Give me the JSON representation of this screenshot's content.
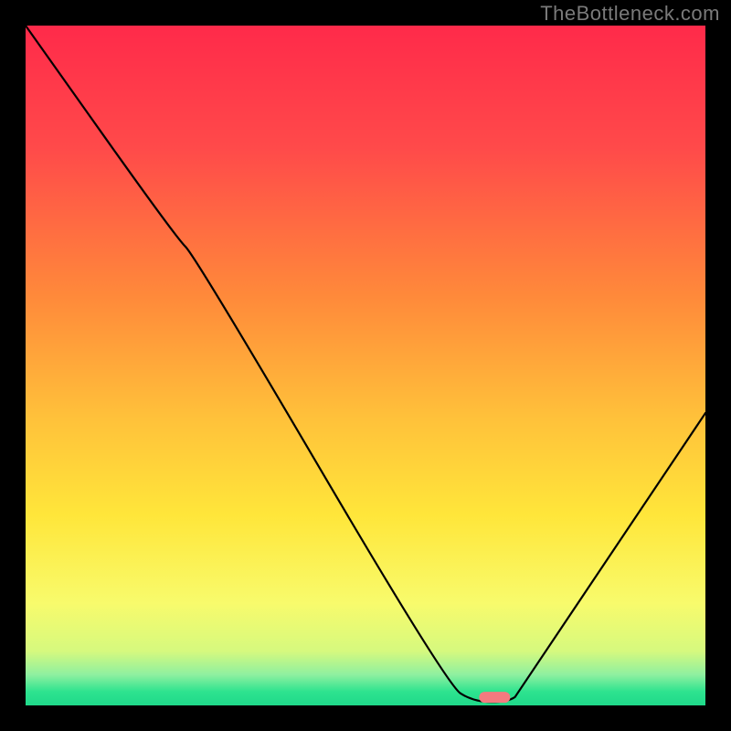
{
  "watermark": "TheBottleneck.com",
  "chart_data": {
    "type": "line",
    "title": "",
    "xlabel": "",
    "ylabel": "",
    "xlim": [
      0,
      100
    ],
    "ylim": [
      0,
      100
    ],
    "curve": [
      {
        "x": 0,
        "y": 100
      },
      {
        "x": 22,
        "y": 69
      },
      {
        "x": 25,
        "y": 66
      },
      {
        "x": 62,
        "y": 3
      },
      {
        "x": 66,
        "y": 0.5
      },
      {
        "x": 71,
        "y": 0.5
      },
      {
        "x": 73,
        "y": 2
      },
      {
        "x": 100,
        "y": 43
      }
    ],
    "marker": {
      "x": 69,
      "y": 1.2,
      "color": "#f47a7f"
    },
    "background_gradient": {
      "stops": [
        {
          "offset": 0.0,
          "color": "#ff2a4a"
        },
        {
          "offset": 0.18,
          "color": "#ff4a4a"
        },
        {
          "offset": 0.4,
          "color": "#ff8a3a"
        },
        {
          "offset": 0.58,
          "color": "#ffc23a"
        },
        {
          "offset": 0.72,
          "color": "#ffe63a"
        },
        {
          "offset": 0.85,
          "color": "#f8fb6c"
        },
        {
          "offset": 0.92,
          "color": "#d6f97e"
        },
        {
          "offset": 0.955,
          "color": "#8ef0a0"
        },
        {
          "offset": 0.98,
          "color": "#2de38f"
        },
        {
          "offset": 1.0,
          "color": "#1fd98a"
        }
      ]
    }
  }
}
